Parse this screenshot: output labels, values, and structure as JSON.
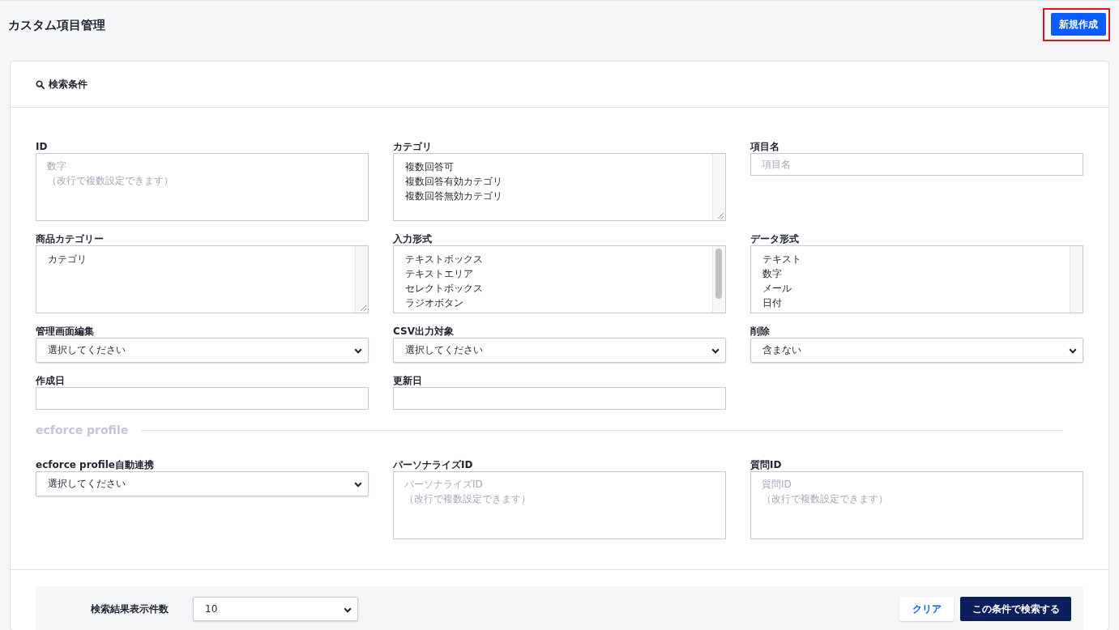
{
  "page": {
    "title": "カスタム項目管理",
    "new_button": {
      "label": "新規作成",
      "highlighted": true
    }
  },
  "search_panel": {
    "title": "検索条件",
    "fields": [
      {
        "label": "ID",
        "kind": "textarea",
        "placeholder": [
          "数字",
          "（改行で複数設定できます）"
        ]
      },
      {
        "label": "カテゴリ",
        "kind": "listbox",
        "options": [
          "複数回答可",
          "複数回答有効カテゴリ",
          "複数回答無効カテゴリ"
        ],
        "resizable": true,
        "overflow": false
      },
      {
        "label": "項目名",
        "kind": "text",
        "placeholder": [
          "項目名"
        ]
      },
      {
        "label": "商品カテゴリー",
        "kind": "listbox",
        "options": [
          "カテゴリ"
        ],
        "resizable": true,
        "overflow": false
      },
      {
        "label": "入力形式",
        "kind": "listbox",
        "options": [
          "テキストボックス",
          "テキストエリア",
          "セレクトボックス",
          "ラジオボタン"
        ],
        "resizable": false,
        "overflow": true
      },
      {
        "label": "データ形式",
        "kind": "listbox",
        "options": [
          "テキスト",
          "数字",
          "メール",
          "日付"
        ],
        "resizable": false,
        "overflow": false
      },
      {
        "label": "管理画面編集",
        "kind": "select",
        "value": "選択してください"
      },
      {
        "label": "CSV出力対象",
        "kind": "select",
        "value": "選択してください"
      },
      {
        "label": "削除",
        "kind": "select",
        "value": "含まない"
      },
      {
        "label": "作成日",
        "kind": "text"
      },
      {
        "label": "更新日",
        "kind": "text"
      }
    ],
    "profile_section": {
      "title": "ecforce profile",
      "fields": [
        {
          "label": "ecforce profile自動連携",
          "kind": "select",
          "value": "選択してください"
        },
        {
          "label": "パーソナライズID",
          "kind": "textarea",
          "placeholder": [
            "パーソナライズID",
            "（改行で複数設定できます）"
          ]
        },
        {
          "label": "質問ID",
          "kind": "textarea",
          "placeholder": [
            "質問ID",
            "（改行で複数設定できます）"
          ]
        }
      ]
    },
    "footer": {
      "page_size_label": "検索結果表示件数",
      "page_size": "10",
      "buttons": [
        {
          "label": "クリア",
          "kind": "secondary"
        },
        {
          "label": "この条件で検索する",
          "kind": "primary"
        }
      ]
    }
  }
}
